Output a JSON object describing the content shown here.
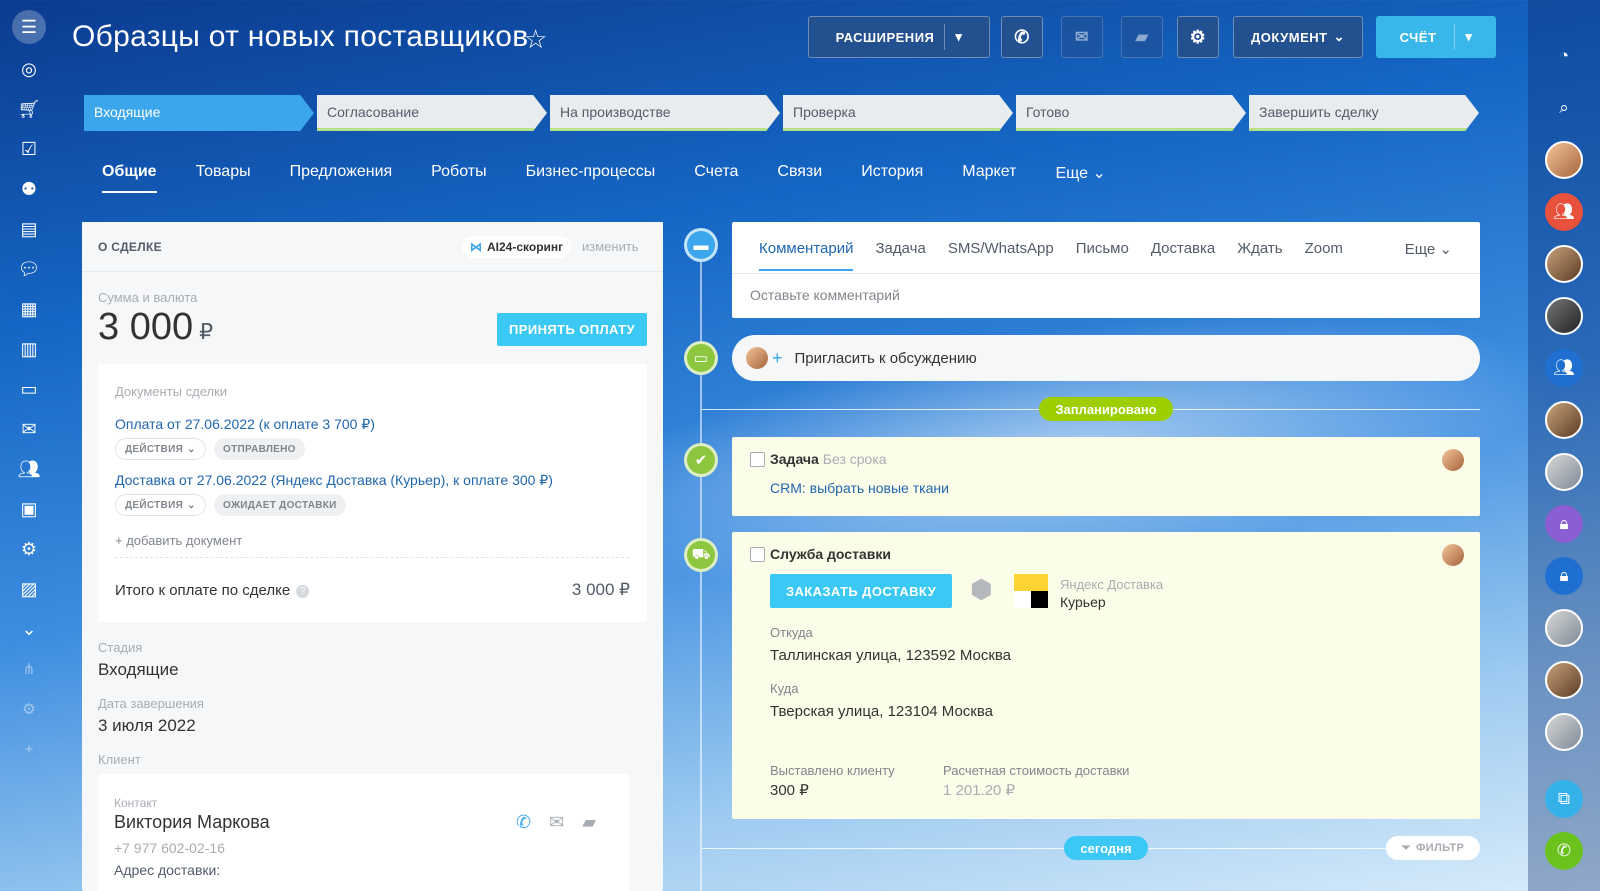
{
  "page": {
    "title": "Образцы от новых поставщиков"
  },
  "header": {
    "extensions_label": "РАСШИРЕНИЯ",
    "document_label": "ДОКУМЕНТ",
    "invoice_label": "СЧЁТ"
  },
  "stages": [
    {
      "label": "Входящие",
      "active": true
    },
    {
      "label": "Согласование",
      "active": false
    },
    {
      "label": "На производстве",
      "active": false
    },
    {
      "label": "Проверка",
      "active": false
    },
    {
      "label": "Готово",
      "active": false
    },
    {
      "label": "Завершить сделку",
      "active": false
    }
  ],
  "tabs": [
    "Общие",
    "Товары",
    "Предложения",
    "Роботы",
    "Бизнес-процессы",
    "Счета",
    "Связи",
    "История",
    "Маркет",
    "Еще"
  ],
  "deal": {
    "section_title": "О СДЕЛКЕ",
    "ai_badge": "AI24-скоринг",
    "change_link": "изменить",
    "sum_label": "Сумма и валюта",
    "sum_value": "3 000",
    "currency": "₽",
    "accept_payment": "ПРИНЯТЬ ОПЛАТУ",
    "documents_label": "Документы сделки",
    "documents": [
      {
        "title": "Оплата от 27.06.2022 (к оплате 3 700 ₽)",
        "actions": "ДЕЙСТВИЯ",
        "status": "ОТПРАВЛЕНО"
      },
      {
        "title": "Доставка от 27.06.2022 (Яндекс Доставка (Курьер), к оплате 300 ₽)",
        "actions": "ДЕЙСТВИЯ",
        "status": "ОЖИДАЕТ ДОСТАВКИ"
      }
    ],
    "add_document": "+ добавить документ",
    "total_label": "Итого к оплате по сделке",
    "total_value": "3 000 ₽",
    "stage_label": "Стадия",
    "stage_value": "Входящие",
    "close_date_label": "Дата завершения",
    "close_date_value": "3 июля 2022",
    "client_label": "Клиент",
    "contact_label": "Контакт",
    "contact_name": "Виктория Маркова",
    "contact_phone": "+7 977 602-02-16",
    "address_label": "Адрес доставки:"
  },
  "timeline": {
    "composer_tabs": [
      "Комментарий",
      "Задача",
      "SMS/WhatsApp",
      "Письмо",
      "Доставка",
      "Ждать",
      "Zoom"
    ],
    "composer_more": "Еще",
    "comment_placeholder": "Оставьте комментарий",
    "invite_text": "Пригласить к обсуждению",
    "planned_badge": "Запланировано",
    "task": {
      "title": "Задача",
      "deadline": "Без срока",
      "link": "CRM: выбрать новые ткани"
    },
    "delivery": {
      "title": "Служба доставки",
      "order_button": "ЗАКАЗАТЬ ДОСТАВКУ",
      "provider_name": "Яндекс Доставка",
      "provider_service": "Курьер",
      "from_label": "Откуда",
      "from_value": "Таллинская улица, 123592 Москва",
      "to_label": "Куда",
      "to_value": "Тверская улица, 123104 Москва",
      "billed_label": "Выставлено клиенту",
      "billed_value": "300 ₽",
      "estimated_label": "Расчетная стоимость доставки",
      "estimated_value": "1 201.20 ₽"
    },
    "today_badge": "сегодня",
    "filter_label": "ФИЛЬТР"
  },
  "colors": {
    "accent": "#3bc8f5",
    "stage_active": "#3ba6ec",
    "planned": "#9dcf00",
    "link": "#2067b0"
  }
}
